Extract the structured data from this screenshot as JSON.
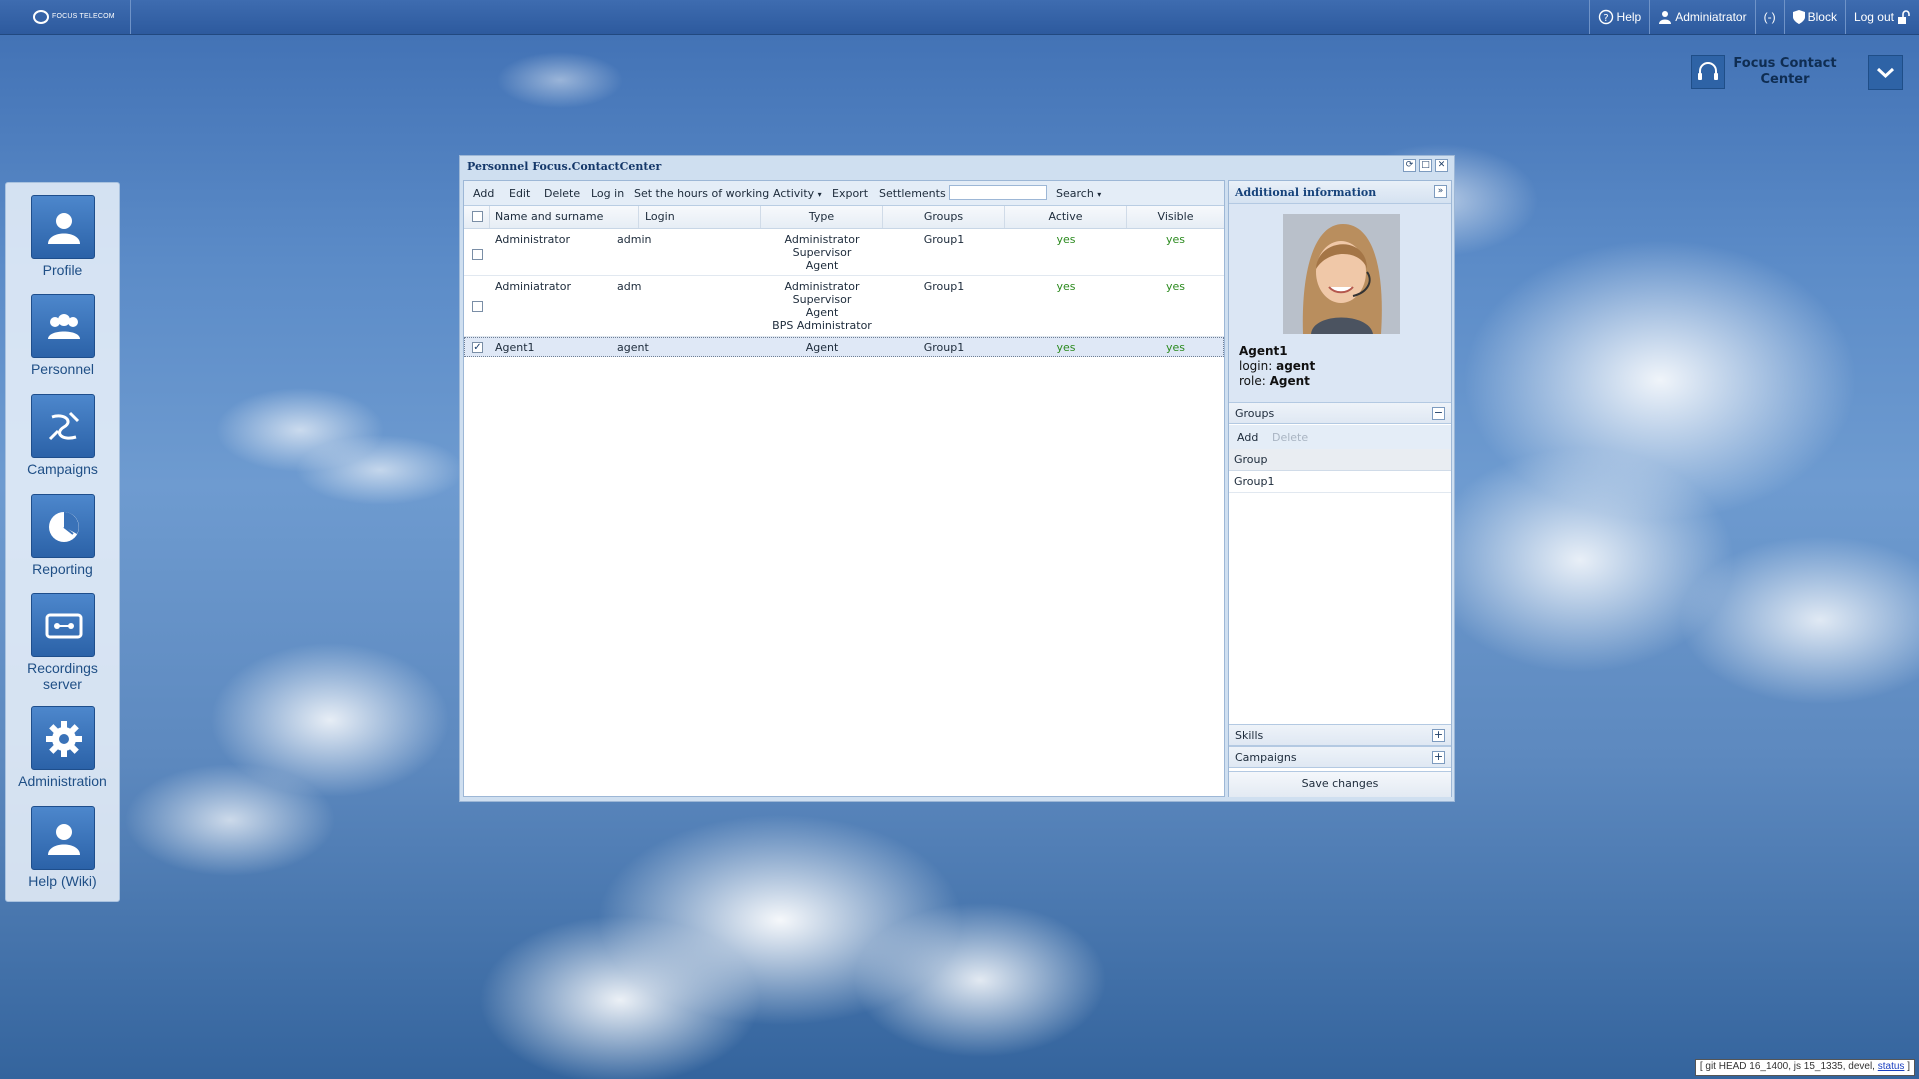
{
  "topbar": {
    "logo_text": "FOCUS TELECOM",
    "help": "Help",
    "user": "Adminiatrator",
    "status": "(-)",
    "block": "Block",
    "logout": "Log out"
  },
  "brand": {
    "title_line1": "Focus Contact",
    "title_line2": "Center"
  },
  "dock": {
    "items": [
      {
        "label": "Profile",
        "icon": "user-icon"
      },
      {
        "label": "Personnel",
        "icon": "users-icon"
      },
      {
        "label": "Campaigns",
        "icon": "campaigns-icon"
      },
      {
        "label": "Reporting",
        "icon": "pie-chart-icon"
      },
      {
        "label": "Recordings",
        "label2": "server",
        "icon": "cassette-icon"
      },
      {
        "label": "Administration",
        "icon": "gear-icon"
      },
      {
        "label": "Help (Wiki)",
        "icon": "user-icon"
      }
    ]
  },
  "window": {
    "title": "Personnel Focus.ContactCenter",
    "toolbar": {
      "add": "Add",
      "edit": "Edit",
      "delete": "Delete",
      "login": "Log in",
      "hours": "Set the hours of working",
      "activity": "Activity",
      "export": "Export",
      "settlements": "Settlements",
      "search_value": "",
      "search": "Search"
    },
    "columns": [
      "Name and surname",
      "Login",
      "Type",
      "Groups",
      "Active",
      "Visible"
    ],
    "rows": [
      {
        "name": "Administrator",
        "login": "admin",
        "type": [
          "Administrator",
          "Supervisor",
          "Agent"
        ],
        "groups": "Group1",
        "active": "yes",
        "visible": "yes",
        "checked": false
      },
      {
        "name": "Adminiatrator",
        "login": "adm",
        "type": [
          "Administrator",
          "Supervisor",
          "Agent",
          "BPS Administrator"
        ],
        "groups": "Group1",
        "active": "yes",
        "visible": "yes",
        "checked": false
      },
      {
        "name": "Agent1",
        "login": "agent",
        "type": [
          "Agent"
        ],
        "groups": "Group1",
        "active": "yes",
        "visible": "yes",
        "checked": true
      }
    ]
  },
  "side": {
    "title": "Additional information",
    "profile": {
      "name": "Agent1",
      "login_label": "login:",
      "login_value": "agent",
      "role_label": "role:",
      "role_value": "Agent"
    },
    "groups": {
      "title": "Groups",
      "add": "Add",
      "delete": "Delete",
      "column": "Group",
      "rows": [
        "Group1"
      ]
    },
    "skills": "Skills",
    "campaigns": "Campaigns",
    "save": "Save changes"
  },
  "status_bar": {
    "text": "[ git HEAD 16_1400, js 15_1335, devel,",
    "link": "status",
    "close": "]"
  },
  "colors": {
    "accent": "#2e63a6",
    "green": "#2b8a1e"
  }
}
